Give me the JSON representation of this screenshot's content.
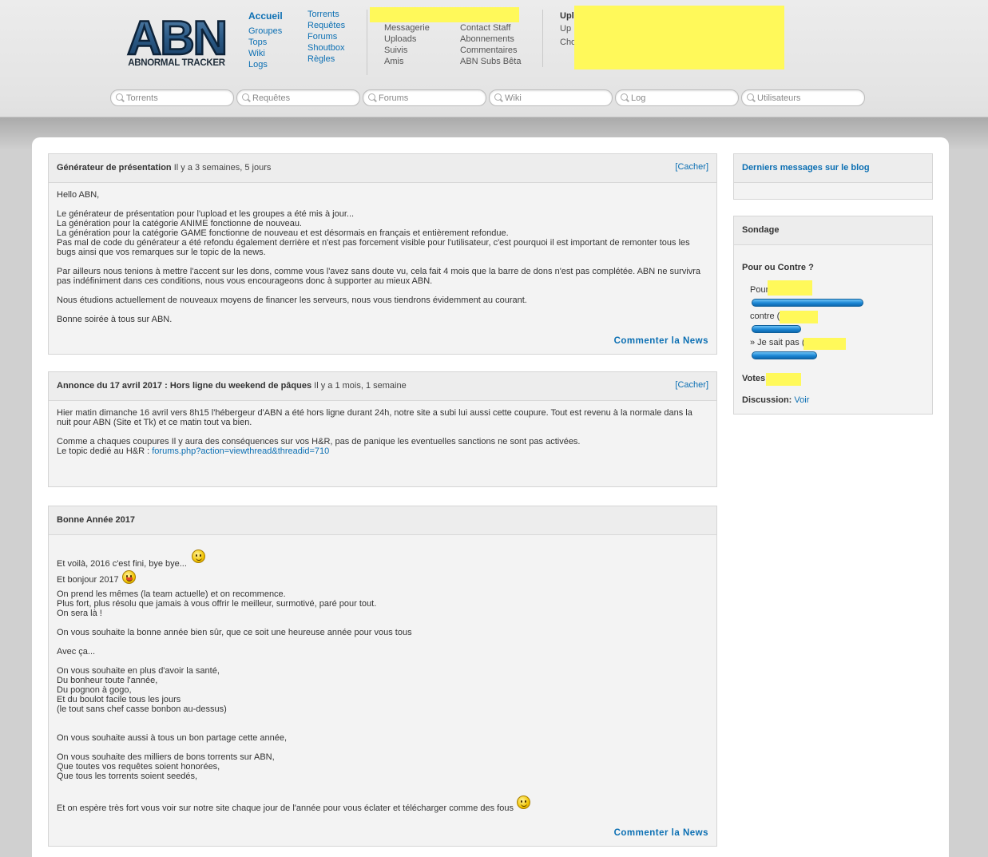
{
  "logo": {
    "main": "ABN",
    "sub": "ABNORMAL TRACKER"
  },
  "nav": {
    "col1": [
      "Accueil",
      "Groupes",
      "Tops",
      "Wiki",
      "Logs"
    ],
    "col2": [
      "Torrents",
      "Requêtes",
      "Forums",
      "Shoutbox",
      "Règles"
    ],
    "col3": [
      "Messagerie",
      "Uploads",
      "Suivis",
      "Amis"
    ],
    "col4": [
      "Contact Staff",
      "Abonnements",
      "Commentaires",
      "ABN Subs Bêta"
    ],
    "stats": {
      "line1": "Upl",
      "line2": "Up :",
      "line3": "Cho"
    }
  },
  "search": {
    "torrents": "Torrents",
    "requests": "Requêtes",
    "forums": "Forums",
    "wiki": "Wiki",
    "log": "Log",
    "users": "Utilisateurs"
  },
  "news": [
    {
      "title": "Générateur de présentation",
      "ago": "Il y a 3 semaines, 5 jours",
      "hide": "[Cacher]",
      "paragraphs": [
        "Hello ABN,",
        "",
        "Le générateur de présentation pour l'upload et les groupes a été mis à jour...",
        "La génération pour la catégorie ANIME fonctionne de nouveau.",
        "La génération pour la catégorie GAME fonctionne de nouveau et est désormais en français et entièrement refondue.",
        "Pas mal de code du générateur a été refondu également derrière et n'est pas forcement visible pour l'utilisateur, c'est pourquoi il est important de remonter tous les bugs ainsi que vos remarques sur le topic de la news.",
        "",
        "Par ailleurs nous tenions à mettre l'accent sur les dons, comme vous l'avez sans doute vu, cela fait 4 mois que la barre de dons n'est pas complétée. ABN ne survivra pas indéfiniment dans ces conditions, nous vous encourageons donc à supporter au mieux ABN.",
        "",
        "Nous étudions actuellement de nouveaux moyens de financer les serveurs, nous vous tiendrons évidemment au courant.",
        "",
        "Bonne soirée à tous sur ABN."
      ],
      "comment": "Commenter la News"
    },
    {
      "title": "Annonce du 17 avril 2017 : Hors ligne du weekend de pâques",
      "ago": "Il y a 1 mois, 1 semaine",
      "hide": "[Cacher]",
      "p1": "Hier matin dimanche 16 avril vers 8h15 l'hébergeur d'ABN a été hors ligne durant 24h, notre site a subi lui aussi cette coupure. Tout est revenu à la normale dans la nuit pour ABN (Site et Tk) et ce matin tout va bien.",
      "p2": "Comme a chaques coupures Il y aura des conséquences sur vos H&R, pas de panique les eventuelles sanctions ne sont pas activées.",
      "p3_prefix": "Le topic dedié au H&R : ",
      "p3_link": "forums.php?action=viewthread&threadid=710"
    },
    {
      "title": "Bonne Année 2017",
      "lines": [
        "Et voilà, 2016 c'est fini, bye bye...",
        "Et bonjour 2017",
        "On prend les mêmes (la team actuelle) et on recommence.",
        "Plus fort, plus résolu que jamais à vous offrir le meilleur, surmotivé, paré pour tout.",
        "On sera là !",
        "On vous souhaite la bonne année bien sûr, que ce soit une heureuse année pour vous tous",
        "Avec ça...",
        "On vous souhaite en plus d'avoir la santé,",
        "Du bonheur toute l'année,",
        "Du pognon à gogo,",
        "Et du boulot facile tous les jours",
        "(le tout sans chef casse bonbon au-dessus)",
        "On vous souhaite aussi à tous un bon partage cette année,",
        "On vous souhaite des milliers de bons torrents sur ABN,",
        "Que toutes vos requêtes soient honorées,",
        "Que tous les torrents soient seedés,",
        "Et on espère très fort vous voir sur notre site chaque jour de l'année pour vous éclater et télécharger comme des fous"
      ],
      "comment": "Commenter la News"
    }
  ],
  "sidebar": {
    "blog_title": "Derniers messages sur le blog",
    "poll_title": "Sondage",
    "poll": {
      "question": "Pour ou Contre ?",
      "options": [
        {
          "label": "Pour",
          "share": 0.9
        },
        {
          "label": "contre (",
          "share": 0.4
        },
        {
          "label": "» Je sait pas (",
          "share": 0.53
        }
      ],
      "votes_label": "Votes",
      "discussion_label": "Discussion:",
      "discussion_link": "Voir"
    }
  },
  "colors": {
    "link": "#0b6fb3",
    "highlight": "#fff95a",
    "bar": "#1b86d4"
  }
}
